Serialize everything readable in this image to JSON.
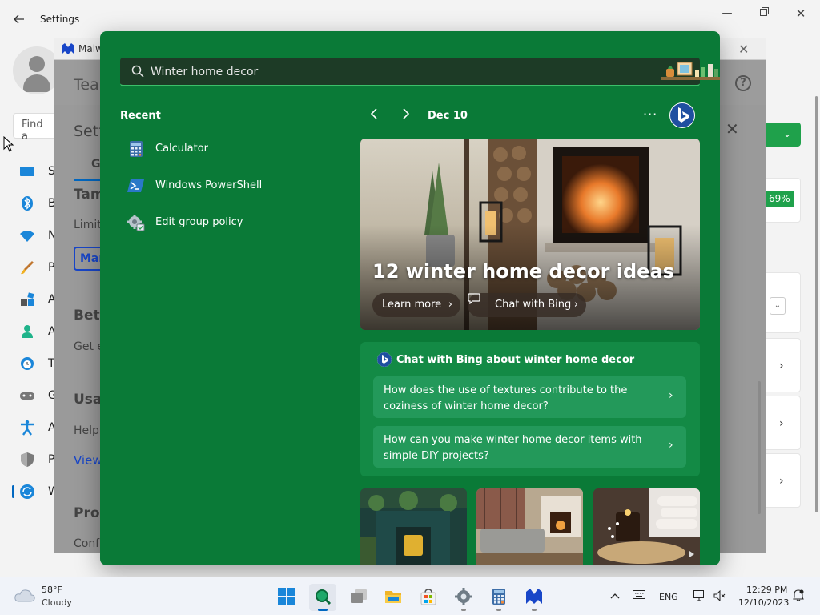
{
  "settings": {
    "title": "Settings",
    "find_placeholder": "Find a",
    "nav_items": [
      {
        "label": "S",
        "icon": "system-icon"
      },
      {
        "label": "B",
        "icon": "bluetooth-icon"
      },
      {
        "label": "N",
        "icon": "network-icon"
      },
      {
        "label": "P",
        "icon": "personalization-icon"
      },
      {
        "label": "A",
        "icon": "apps-icon"
      },
      {
        "label": "A",
        "icon": "accounts-icon"
      },
      {
        "label": "T",
        "icon": "time-icon"
      },
      {
        "label": "G",
        "icon": "gaming-icon"
      },
      {
        "label": "A",
        "icon": "accessibility-icon"
      },
      {
        "label": "P",
        "icon": "privacy-icon"
      },
      {
        "label": "W",
        "icon": "windows-update-icon"
      }
    ]
  },
  "malwarebytes": {
    "tab_title": "Malw",
    "header_title": "Tea",
    "settings_title": "Setti",
    "tab_label": "G",
    "texts": [
      {
        "text": "Tam"
      },
      {
        "text": "Limit"
      },
      {
        "text": "Man"
      },
      {
        "text": "Beta"
      },
      {
        "text": "Get e"
      },
      {
        "text": "Usa"
      },
      {
        "text": "Help"
      },
      {
        "text": "View"
      },
      {
        "text": "Prox"
      },
      {
        "text": "Conf"
      }
    ],
    "percent": "69%"
  },
  "search": {
    "query": "Winter home decor",
    "recent_title": "Recent",
    "recent_items": [
      {
        "label": "Calculator",
        "icon": "calculator-icon"
      },
      {
        "label": "Windows PowerShell",
        "icon": "powershell-icon"
      },
      {
        "label": "Edit group policy",
        "icon": "group-policy-icon"
      }
    ],
    "date": "Dec 10",
    "more": "···",
    "hero": {
      "title": "12 winter home decor ideas",
      "learn_more": "Learn more",
      "chat_with_bing": "Chat with Bing"
    },
    "chat_card": {
      "title": "Chat with Bing about winter home decor",
      "questions": [
        "How does the use of textures contribute to the coziness of winter home decor?",
        "How can you make winter home decor items with simple DIY projects?"
      ]
    }
  },
  "taskbar": {
    "temperature": "58°F",
    "condition": "Cloudy",
    "language": "ENG",
    "time": "12:29 PM",
    "date": "12/10/2023",
    "apps": [
      "start-icon",
      "search-icon",
      "task-view-icon",
      "file-explorer-icon",
      "store-icon",
      "settings-icon",
      "calculator-icon",
      "malwarebytes-icon"
    ]
  },
  "colors": {
    "flyout_green": "#0a7a37",
    "accent_blue": "#0067c0",
    "malwarebytes_green": "#1fa14b"
  }
}
